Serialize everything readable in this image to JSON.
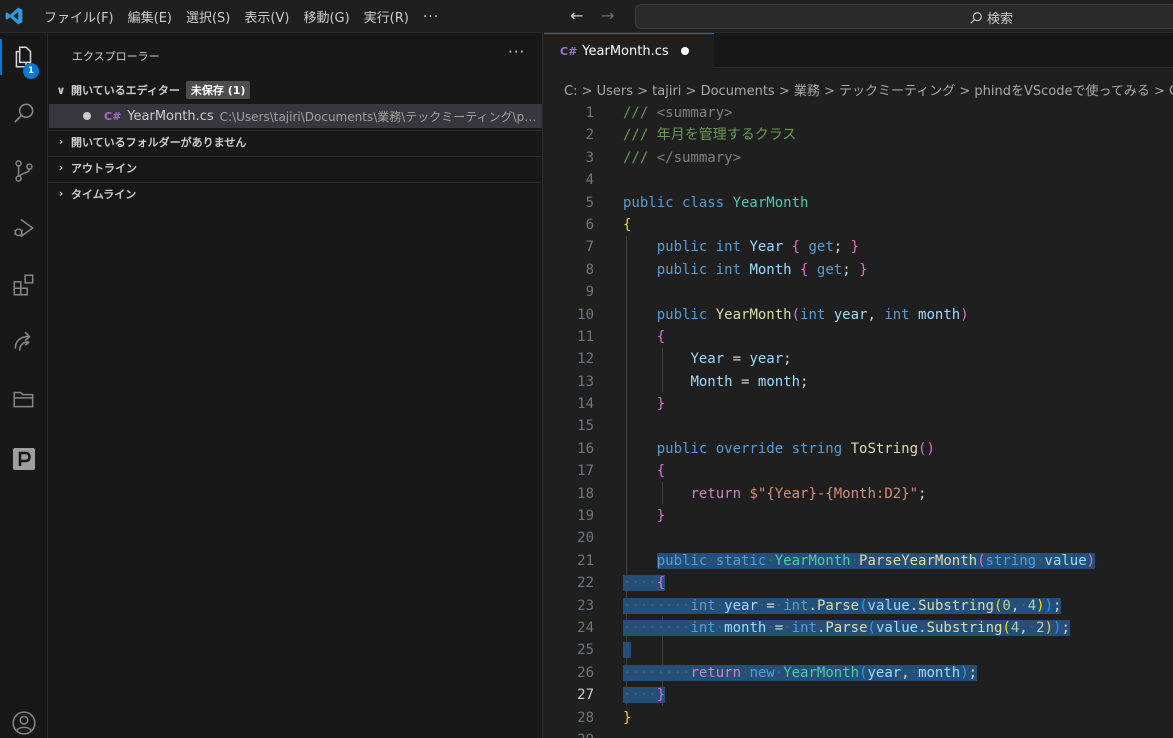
{
  "menu": {
    "items": [
      "ファイル(F)",
      "編集(E)",
      "選択(S)",
      "表示(V)",
      "移動(G)",
      "実行(R)"
    ],
    "more": "···"
  },
  "search": {
    "label": "検索"
  },
  "activity": {
    "badge_count": "1"
  },
  "sidebar": {
    "title": "エクスプローラー",
    "more": "···",
    "open_editors": {
      "label": "開いているエディター",
      "badge": "未保存 (1)"
    },
    "open_file": {
      "name": "YearMonth.cs",
      "path": "C:\\Users\\tajiri\\Documents\\業務\\テックミーティング\\phi..."
    },
    "no_folder": "開いているフォルダーがありません",
    "outline": "アウトライン",
    "timeline": "タイムライン"
  },
  "editor": {
    "tab_label": "YearMonth.cs",
    "breadcrumb": "C: > Users > tajiri > Documents > 業務 > テックミーティング > phindをVScodeで使ってみる > C#",
    "current_line": 27,
    "code": {
      "l1_tag": "<summary>",
      "l2_comment": "/// 年月を管理するクラス",
      "l3_tag": "</summary>",
      "class_name": "YearMonth",
      "prop_year": "Year",
      "prop_month": "Month",
      "method_tostring": "ToString",
      "format_string": "\"{Year}-{Month:D2}\"",
      "method_parse": "ParseYearMonth"
    }
  },
  "colors": {
    "accent": "#0078d4",
    "selection": "#264f78",
    "background": "#1f1f1f"
  }
}
